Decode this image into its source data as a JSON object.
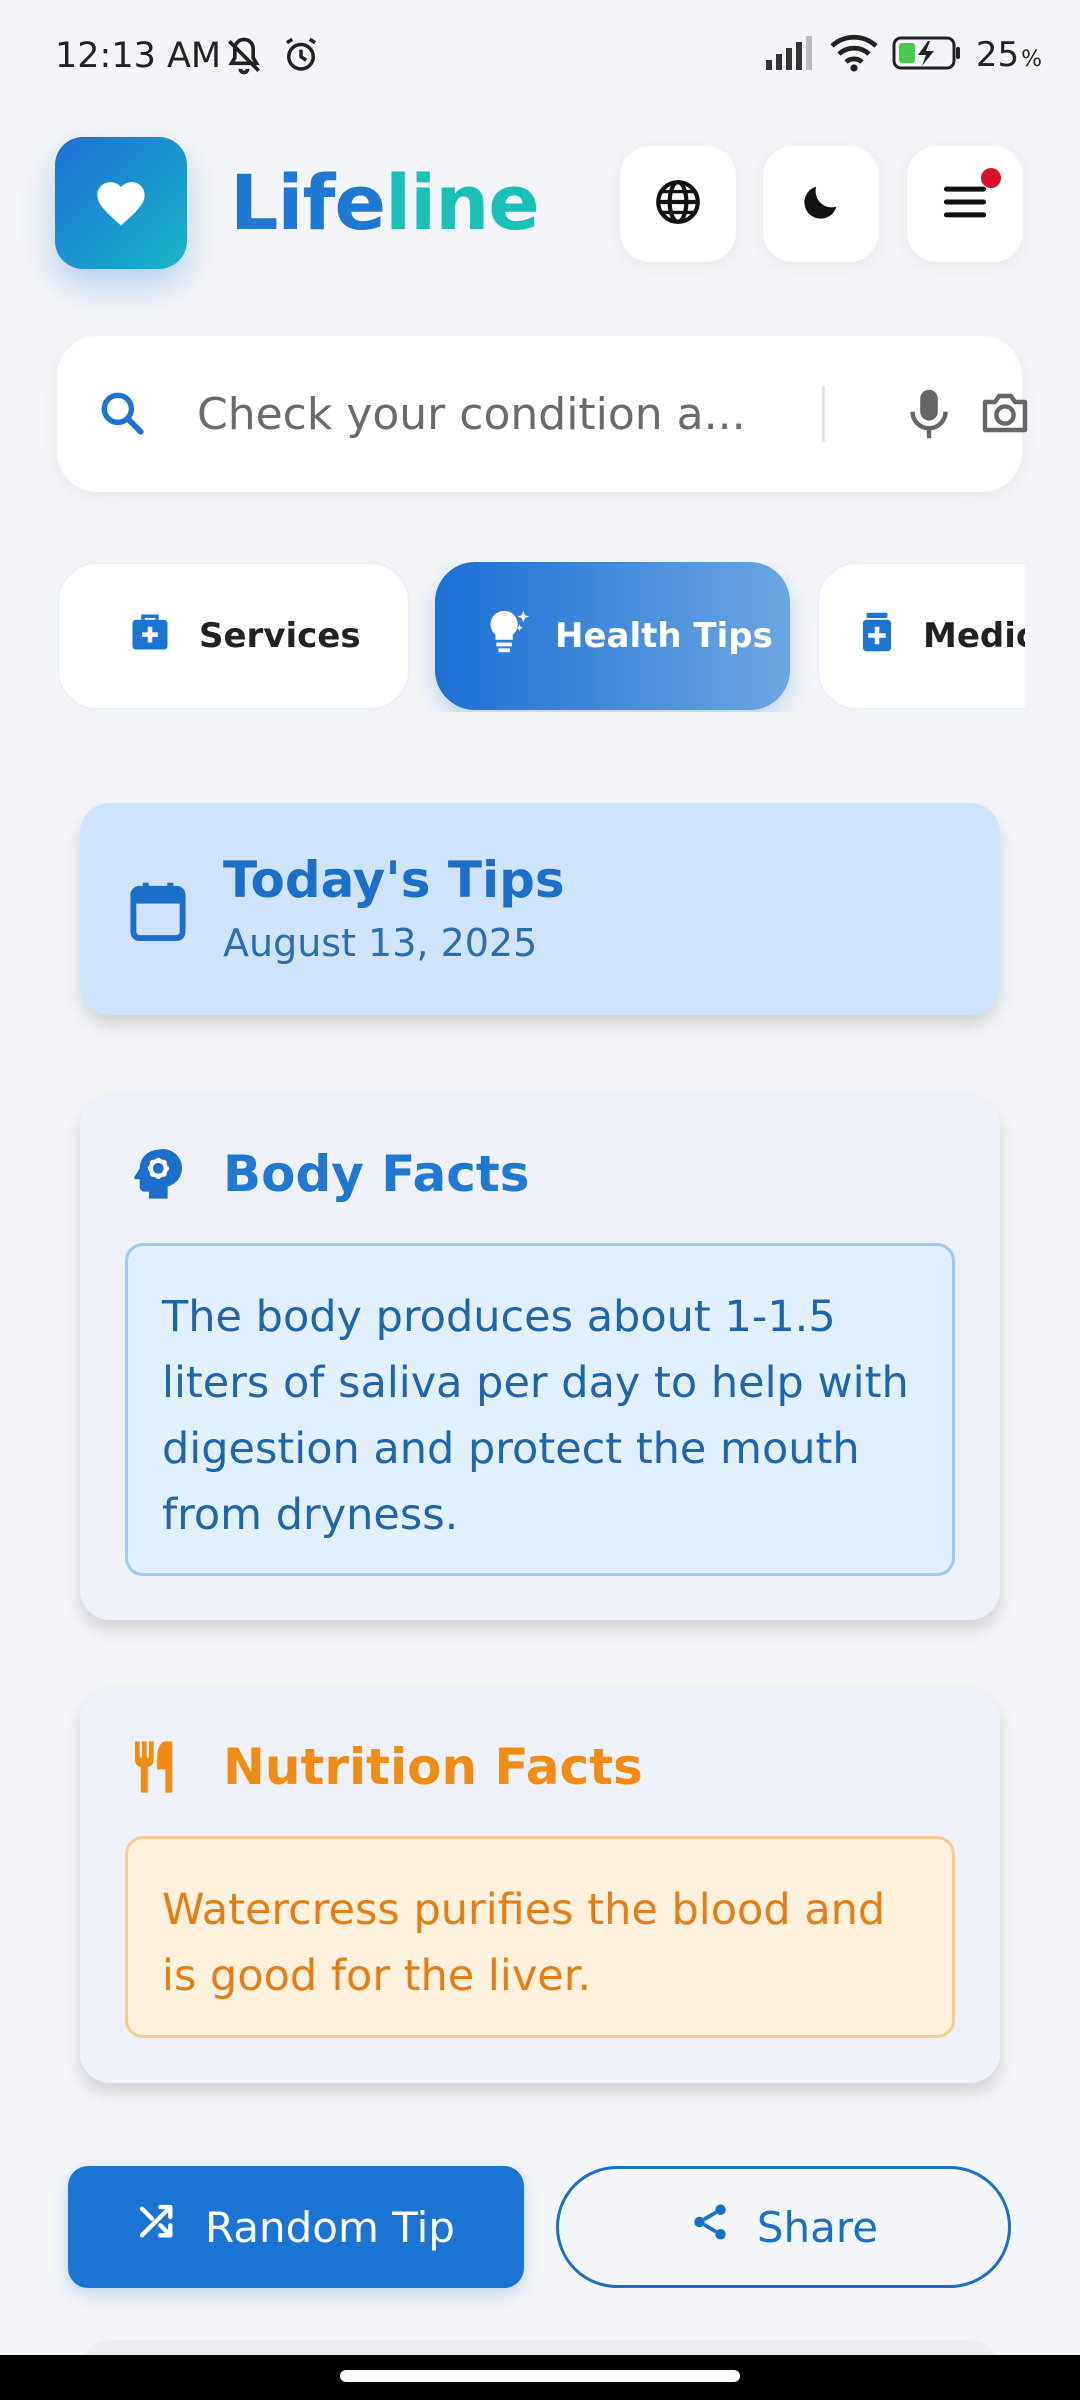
{
  "status_bar": {
    "time": "12:13 AM",
    "battery": "25"
  },
  "header": {
    "title_part1": "Life",
    "title_part2": "line"
  },
  "search": {
    "placeholder": "Check your condition a..."
  },
  "tabs": [
    {
      "label": "Services",
      "icon": "medical-bag-icon"
    },
    {
      "label": "Health Tips",
      "icon": "lightbulb-icon"
    },
    {
      "label": "Medic",
      "icon": "medicine-bottle-icon"
    }
  ],
  "today": {
    "title": "Today's Tips",
    "date": "August 13, 2025"
  },
  "body_facts": {
    "title": "Body Facts",
    "text": "The body produces about 1-1.5 liters of saliva per day to help with digestion and protect the mouth from dryness."
  },
  "nutrition_facts": {
    "title": "Nutrition Facts",
    "text": "Watercress purifies the blood and is good for the liver."
  },
  "actions": {
    "random_label": "Random Tip",
    "share_label": "Share"
  },
  "colors": {
    "brand_blue": "#1f78d1",
    "brand_teal": "#18c0b6",
    "nutrition_orange": "#f08c14",
    "notification_red": "#d6102d"
  }
}
